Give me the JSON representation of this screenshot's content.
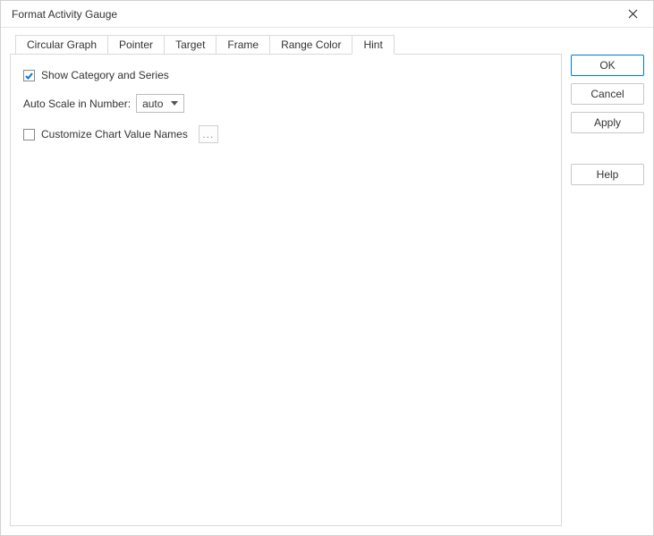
{
  "title": "Format Activity Gauge",
  "tabs": {
    "circular_graph": "Circular Graph",
    "pointer": "Pointer",
    "target": "Target",
    "frame": "Frame",
    "range_color": "Range Color",
    "hint": "Hint"
  },
  "hint_panel": {
    "show_category_label": "Show Category and Series",
    "show_category_checked": true,
    "auto_scale_label": "Auto Scale in Number:",
    "auto_scale_value": "auto",
    "customize_label": "Customize Chart Value Names",
    "customize_checked": false,
    "customize_button": "..."
  },
  "buttons": {
    "ok": "OK",
    "cancel": "Cancel",
    "apply": "Apply",
    "help": "Help"
  }
}
